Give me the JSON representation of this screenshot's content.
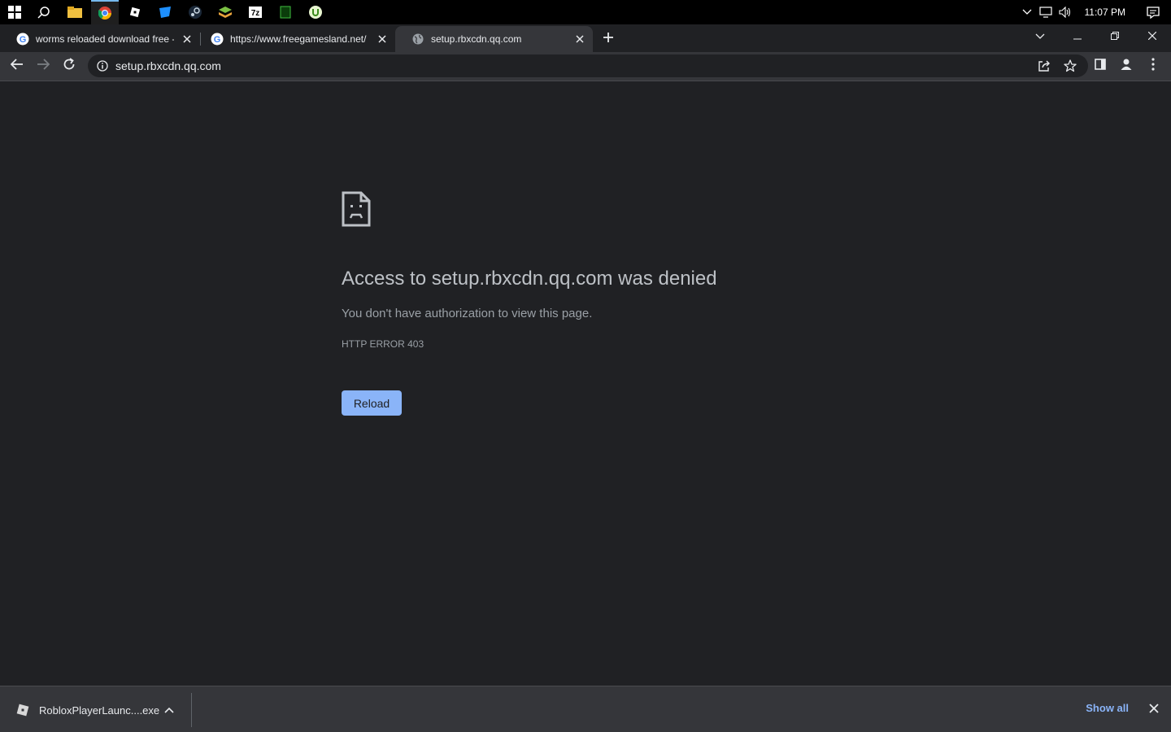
{
  "taskbar": {
    "clock": "11:07 PM"
  },
  "tabs": [
    {
      "title": "worms reloaded download free -",
      "favicon": "google-icon"
    },
    {
      "title": "https://www.freegamesland.net/",
      "favicon": "google-icon"
    },
    {
      "title": "setup.rbxcdn.qq.com",
      "favicon": "globe-icon"
    }
  ],
  "omnibox": {
    "url": "setup.rbxcdn.qq.com"
  },
  "error_page": {
    "title": "Access to setup.rbxcdn.qq.com was denied",
    "description": "You don't have authorization to view this page.",
    "code": "HTTP ERROR 403",
    "reload_label": "Reload"
  },
  "downloads": {
    "file_name": "RobloxPlayerLaunc....exe",
    "show_all_label": "Show all"
  },
  "colors": {
    "page_bg": "#202124",
    "toolbar_bg": "#35363a",
    "accent": "#8ab4f8"
  }
}
